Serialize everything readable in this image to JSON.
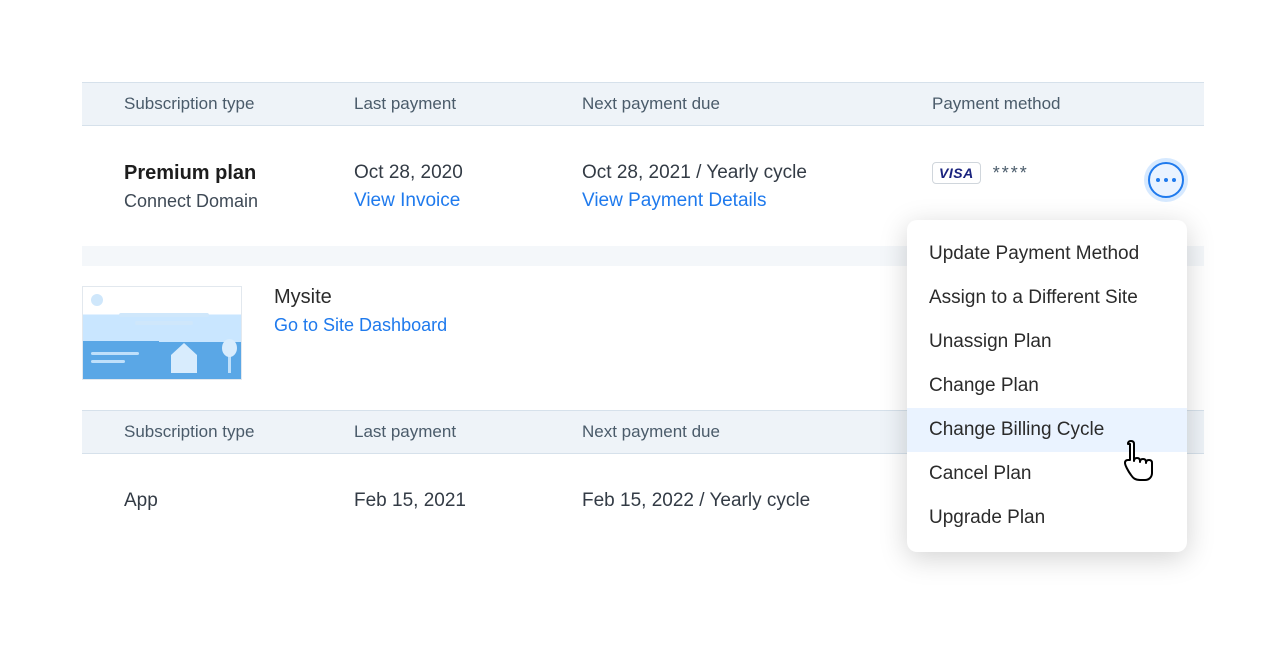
{
  "headers": {
    "type": "Subscription type",
    "last": "Last payment",
    "next": "Next payment due",
    "method": "Payment method"
  },
  "row1": {
    "planName": "Premium plan",
    "planSub": "Connect Domain",
    "lastDate": "Oct 28, 2020",
    "lastLink": "View Invoice",
    "nextDate": "Oct 28, 2021 / Yearly cycle",
    "nextLink": "View Payment Details",
    "cardBrand": "VISA",
    "cardMask": "****"
  },
  "site": {
    "name": "Mysite",
    "link": "Go to Site Dashboard"
  },
  "row2": {
    "planName": "App",
    "lastDate": "Feb 15, 2021",
    "nextDate": "Feb 15, 2022 / Yearly cycle"
  },
  "menu": {
    "items": [
      "Update Payment Method",
      "Assign to a Different Site",
      "Unassign Plan",
      "Change Plan",
      "Change Billing Cycle",
      "Cancel Plan",
      "Upgrade Plan"
    ],
    "hoverIndex": 4
  }
}
